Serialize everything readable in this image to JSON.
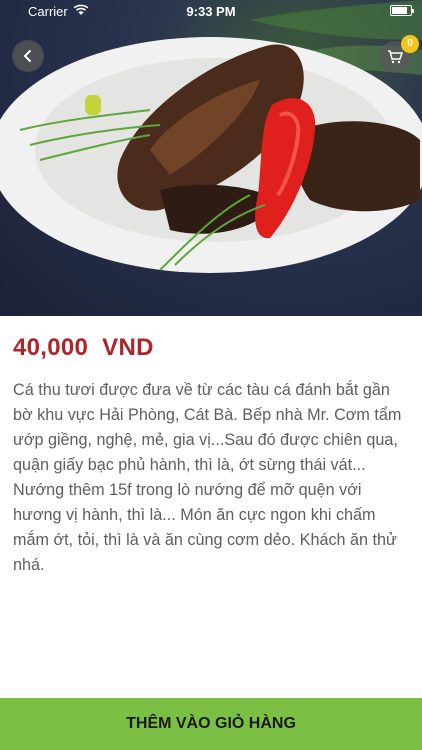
{
  "status_bar": {
    "carrier": "Carrier",
    "time": "9:33 PM",
    "battery_level": 0.85
  },
  "header": {
    "back_icon": "chevron-left-icon",
    "cart_icon": "shopping-cart-icon",
    "cart_count": "0"
  },
  "product": {
    "price": "40,000  VND",
    "description": "Cá thu tươi được đưa về từ các tàu cá đánh bắt gần bờ khu vực Hải Phòng, Cát Bà. Bếp nhà Mr. Cơm tẩm ướp giềng, nghệ, mẻ, gia vị...Sau đó được chiên qua, quận giấy bạc phủ hành, thì là, ớt sừng thái vát... Nướng thêm 15f trong lò nướng để mỡ quện với hương vị hành, thì là... Món ăn cực ngon khi chấm mắm ớt, tỏi, thì là và ăn cùng cơm dẻo. Khách ăn thử nhá."
  },
  "footer": {
    "add_to_cart_label": "THÊM VÀO GIỎ HÀNG"
  },
  "colors": {
    "price": "#b0232a",
    "button_bg": "#7cbf45",
    "badge": "#f5c518"
  }
}
